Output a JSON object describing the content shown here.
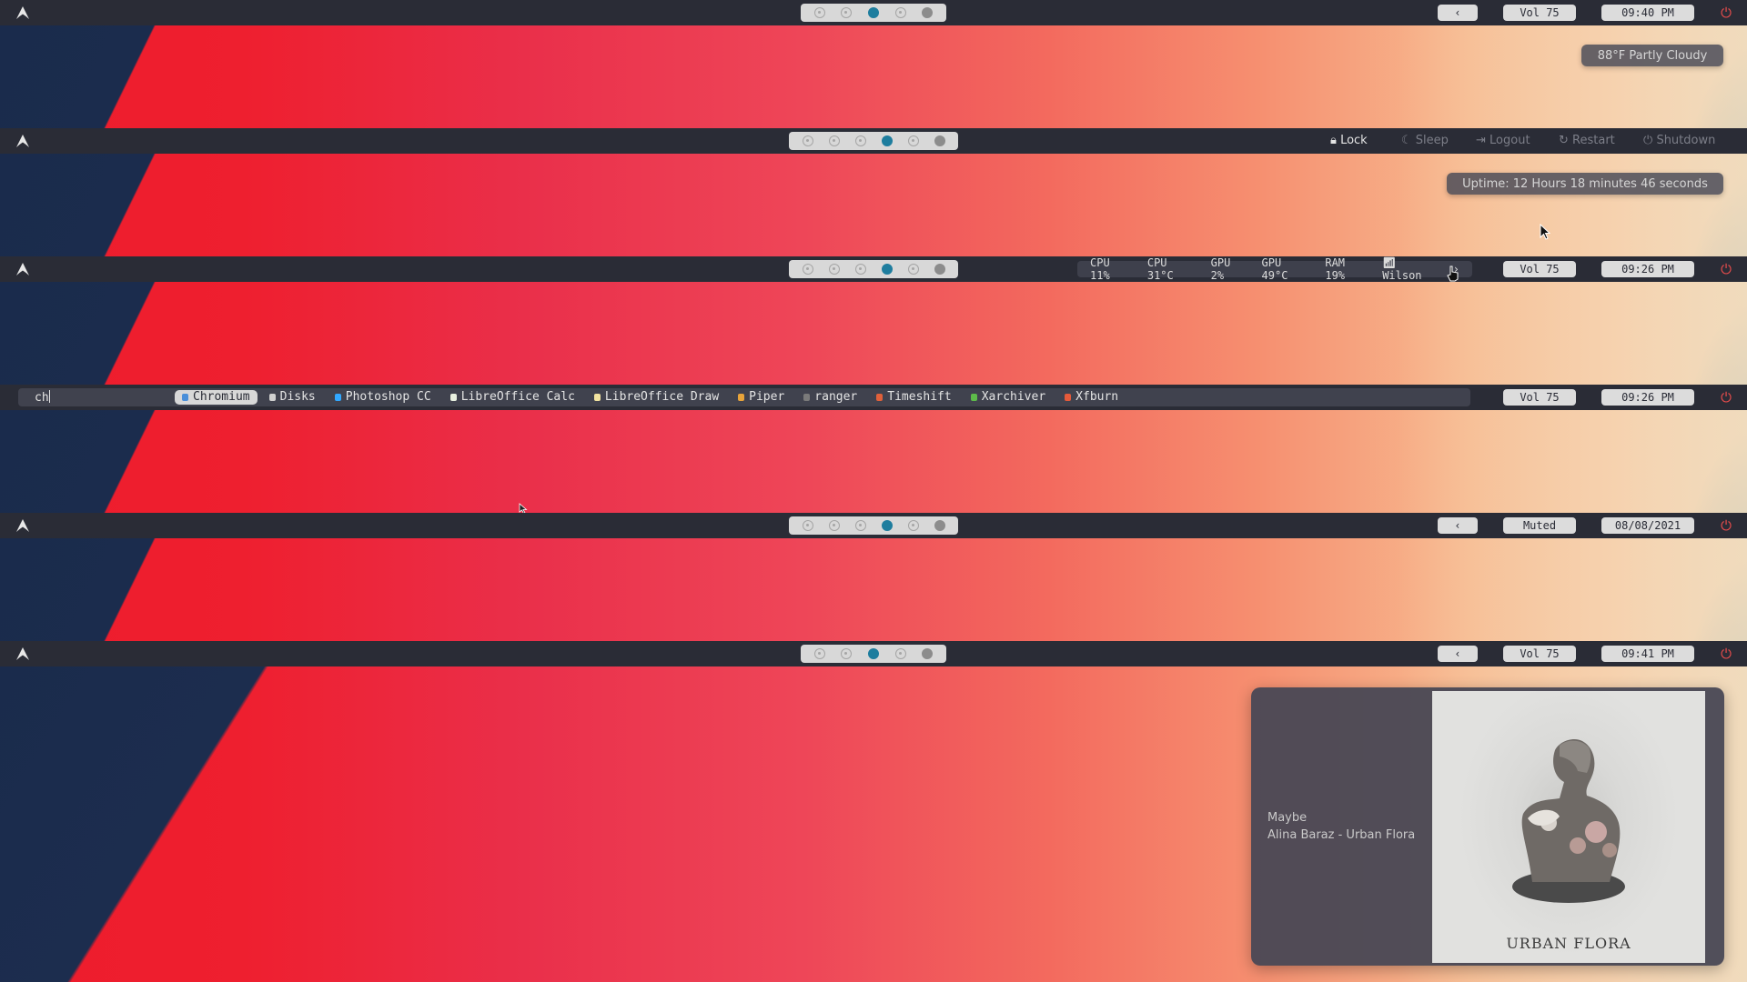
{
  "bars": [
    {
      "workspaces": [
        "inactive",
        "inactive",
        "active",
        "inactive",
        "full"
      ],
      "prev_label": "‹",
      "volume": "Vol 75",
      "clock": "09:40 PM",
      "tooltip": "88°F Partly Cloudy"
    },
    {
      "workspaces": [
        "inactive",
        "inactive",
        "inactive",
        "active",
        "inactive",
        "full"
      ],
      "session": {
        "lock": "Lock",
        "sleep": "Sleep",
        "logout": "Logout",
        "restart": "Restart",
        "shutdown": "Shutdown"
      },
      "tooltip": "Uptime: 12 Hours 18 minutes 46 seconds"
    },
    {
      "workspaces": [
        "inactive",
        "inactive",
        "inactive",
        "active",
        "inactive",
        "full"
      ],
      "sysinfo": {
        "cpu": "CPU 11%",
        "cpu_temp": "CPU 31°C",
        "gpu": "GPU 2%",
        "gpu_temp": "GPU 49°C",
        "ram": "RAM 19%",
        "wifi": "Wilson",
        "arrow": "›"
      },
      "volume": "Vol 75",
      "clock": "09:26 PM"
    },
    {
      "launcher": {
        "query": "ch",
        "items": [
          {
            "label": "Chromium",
            "color": "#4a8fd9",
            "selected": true
          },
          {
            "label": "Disks",
            "color": "#d0d0d0"
          },
          {
            "label": "Photoshop CC",
            "color": "#31a8ff"
          },
          {
            "label": "LibreOffice Calc",
            "color": "#e8f0e0"
          },
          {
            "label": "LibreOffice Draw",
            "color": "#f2e3a0"
          },
          {
            "label": "Piper",
            "color": "#e8a43a"
          },
          {
            "label": "ranger",
            "color": "#7a7a7a"
          },
          {
            "label": "Timeshift",
            "color": "#e0603a"
          },
          {
            "label": "Xarchiver",
            "color": "#5dbb4a"
          },
          {
            "label": "Xfburn",
            "color": "#e55a3a"
          }
        ]
      },
      "volume": "Vol 75",
      "clock": "09:26 PM"
    },
    {
      "workspaces": [
        "inactive",
        "inactive",
        "inactive",
        "active",
        "inactive",
        "full"
      ],
      "prev_label": "‹",
      "volume": "Muted",
      "clock": "08/08/2021"
    },
    {
      "workspaces": [
        "inactive",
        "inactive",
        "active",
        "inactive",
        "full"
      ],
      "prev_label": "‹",
      "volume": "Vol 75",
      "clock": "09:41 PM"
    }
  ],
  "media": {
    "song": "Maybe",
    "artist_album": "Alina Baraz - Urban Flora",
    "cover_title": "URBAN FLORA"
  },
  "colors": {
    "bar_bg": "#2a2c36",
    "accent": "#1e7d9e",
    "power": "#e94c4c"
  }
}
